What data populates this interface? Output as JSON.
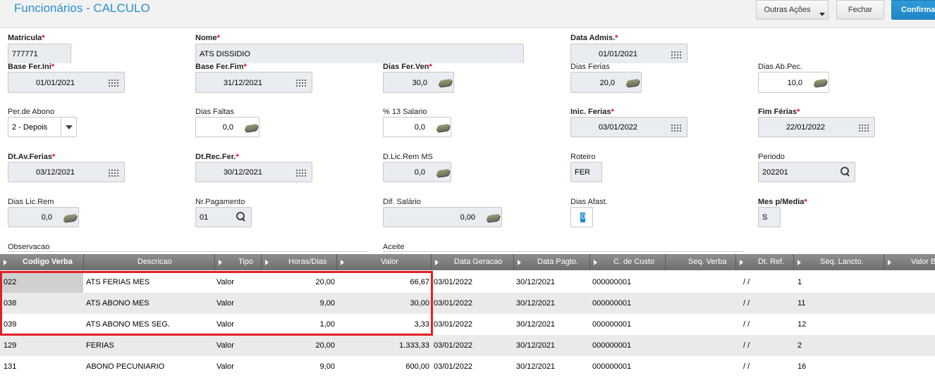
{
  "header": {
    "title": "Funcionários - CALCULO",
    "buttons": {
      "outras_acoes": "Outras Ações",
      "fechar": "Fechar",
      "confirmar": "Confirmar"
    }
  },
  "form": {
    "required_mark": "*",
    "matricula": {
      "label": "Matricula",
      "value": "777771"
    },
    "nome": {
      "label": "Nome",
      "value": "ATS DISSIDIO"
    },
    "data_admis": {
      "label": "Data Admis.",
      "value": "01/01/2021"
    },
    "base_fer_ini": {
      "label": "Base Fer.Ini",
      "value": "01/01/2021"
    },
    "base_fer_fim": {
      "label": "Base Fer.Fim",
      "value": "31/12/2021"
    },
    "dias_fer_ven": {
      "label": "Dias Fer.Ven",
      "value": "30,0"
    },
    "dias_ferias": {
      "label": "Dias Ferias",
      "value": "20,0"
    },
    "dias_ab_pec": {
      "label": "Dias Ab.Pec.",
      "value": "10,0"
    },
    "per_de_abono": {
      "label": "Per.de Abono",
      "value": "2 - Depois"
    },
    "dias_faltas": {
      "label": "Dias Faltas",
      "value": "0,0"
    },
    "pct_13_salario": {
      "label": "% 13 Salario",
      "value": "0,0"
    },
    "inic_ferias": {
      "label": "Inic. Ferias",
      "value": "03/01/2022"
    },
    "fim_ferias": {
      "label": "Fim Férias",
      "value": "22/01/2022"
    },
    "dt_av_ferias": {
      "label": "Dt.Av.Ferias",
      "value": "03/12/2021"
    },
    "dt_rec_fer": {
      "label": "Dt.Rec.Fer.",
      "value": "30/12/2021"
    },
    "d_lic_rem_ms": {
      "label": "D.Lic.Rem MS",
      "value": "0,0"
    },
    "roteiro": {
      "label": "Roteiro",
      "value": "FER"
    },
    "periodo": {
      "label": "Periodo",
      "value": "202201"
    },
    "dias_lic_rem": {
      "label": "Dias Lic.Rem",
      "value": "0,0"
    },
    "nr_pagamento": {
      "label": "Nr.Pagamento",
      "value": "01"
    },
    "dif_salario": {
      "label": "Dif. Salário",
      "value": "0,00"
    },
    "dias_afast": {
      "label": "Dias Afast.",
      "value": "0"
    },
    "mes_p_media": {
      "label": "Mes p/Media",
      "value": "S"
    },
    "observacao": {
      "label": "Observacao"
    },
    "aceite": {
      "label": "Aceite"
    }
  },
  "grid": {
    "columns": [
      "Codigo Verba",
      "Descricao",
      "Tipo",
      "Horas/Dias",
      "Valor",
      "Data Geracao",
      "Data Pagto.",
      "C. de Custo",
      "Seq. Verba",
      "Dt. Ref.",
      "Seq. Lancto.",
      "Valor B"
    ],
    "rows": [
      {
        "codigo": "022",
        "descricao": "ATS FERIAS MES",
        "tipo": "Valor",
        "horas": "20,00",
        "valor": "66,67",
        "data_geracao": "03/01/2022",
        "data_pagto": "30/12/2021",
        "custo": "000000001",
        "dt_ref": "/ /",
        "seq_lancto": "1"
      },
      {
        "codigo": "038",
        "descricao": "ATS ABONO MES",
        "tipo": "Valor",
        "horas": "9,00",
        "valor": "30,00",
        "data_geracao": "03/01/2022",
        "data_pagto": "30/12/2021",
        "custo": "000000001",
        "dt_ref": "/ /",
        "seq_lancto": "11"
      },
      {
        "codigo": "039",
        "descricao": "ATS ABONO MES SEG.",
        "tipo": "Valor",
        "horas": "1,00",
        "valor": "3,33",
        "data_geracao": "03/01/2022",
        "data_pagto": "30/12/2021",
        "custo": "000000001",
        "dt_ref": "/ /",
        "seq_lancto": "12"
      },
      {
        "codigo": "129",
        "descricao": "FERIAS",
        "tipo": "Valor",
        "horas": "20,00",
        "valor": "1.333,33",
        "data_geracao": "03/01/2022",
        "data_pagto": "30/12/2021",
        "custo": "000000001",
        "dt_ref": "/ /",
        "seq_lancto": "2"
      },
      {
        "codigo": "131",
        "descricao": "ABONO PECUNIARIO",
        "tipo": "Valor",
        "horas": "9,00",
        "valor": "600,00",
        "data_geracao": "03/01/2022",
        "data_pagto": "30/12/2021",
        "custo": "000000001",
        "dt_ref": "/ /",
        "seq_lancto": "16"
      }
    ]
  },
  "colors": {
    "title": "#2a8fcf",
    "confirm_button": "#2389c9",
    "required": "#e0001b",
    "highlight_box": "#e11f26",
    "grid_header": "#7d7d7d"
  },
  "icons": [
    "calendar-icon",
    "money-icon",
    "search-icon",
    "chevron-down-icon",
    "column-arrow-icon"
  ]
}
